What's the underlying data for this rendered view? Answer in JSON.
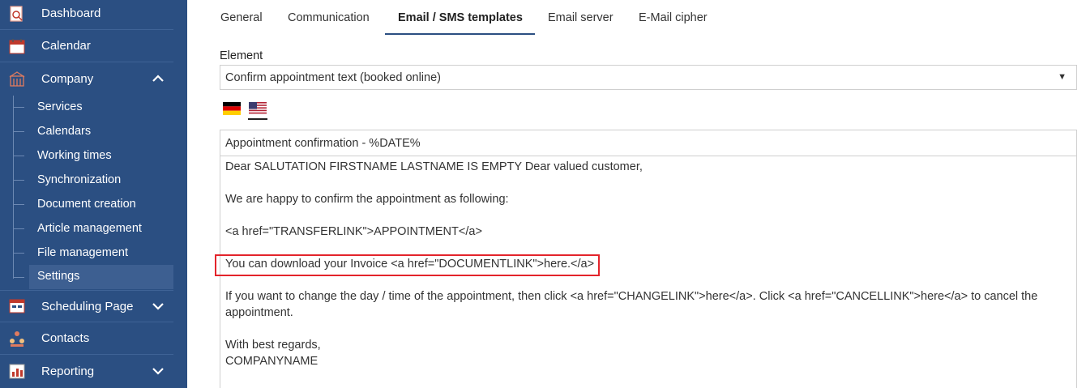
{
  "sidebar": {
    "items": [
      {
        "label": "Dashboard",
        "icon": "dashboard-icon"
      },
      {
        "label": "Calendar",
        "icon": "calendar-icon"
      },
      {
        "label": "Company",
        "icon": "company-icon"
      },
      {
        "label": "Scheduling Page",
        "icon": "scheduling-page-icon"
      },
      {
        "label": "Contacts",
        "icon": "contacts-icon"
      },
      {
        "label": "Reporting",
        "icon": "reporting-icon"
      }
    ],
    "company_sub_items": [
      {
        "label": "Services"
      },
      {
        "label": "Calendars"
      },
      {
        "label": "Working times"
      },
      {
        "label": "Synchronization"
      },
      {
        "label": "Document creation"
      },
      {
        "label": "Article management"
      },
      {
        "label": "File management"
      },
      {
        "label": "Settings"
      }
    ],
    "active_sub_item": "Settings"
  },
  "tabs": [
    {
      "label": "General"
    },
    {
      "label": "Communication"
    },
    {
      "label": "Email / SMS templates"
    },
    {
      "label": "Email server"
    },
    {
      "label": "E-Mail cipher"
    }
  ],
  "active_tab": "Email / SMS templates",
  "element_field": {
    "label": "Element",
    "value": "Confirm appointment text (booked online)"
  },
  "languages": [
    {
      "name": "German",
      "icon": "german-flag-icon"
    },
    {
      "name": "English (US)",
      "icon": "us-flag-icon",
      "selected": true
    }
  ],
  "subject": "Appointment confirmation - %DATE%",
  "body_lines": [
    "Dear SALUTATION FIRSTNAME LASTNAME IS EMPTY Dear valued customer,",
    "We are happy to confirm the appointment as following:",
    "<a href=\"TRANSFERLINK\">APPOINTMENT</a>",
    "You can download your Invoice <a href=\"DOCUMENTLINK\">here.</a>",
    "If you want to change the day / time of the appointment, then click <a href=\"CHANGELINK\">here</a>. Click <a href=\"CANCELLINK\">here</a> to cancel the",
    "appointment.",
    "With best regards,",
    "COMPANYNAME"
  ],
  "colors": {
    "sidebar_bg": "#2b4f82",
    "active_tab_underline": "#2b4f82",
    "highlight_border": "#e3242b"
  }
}
